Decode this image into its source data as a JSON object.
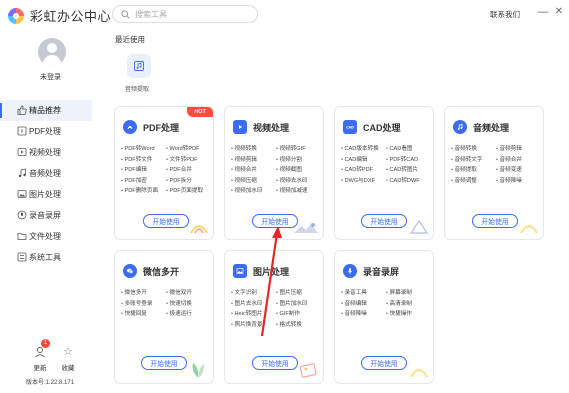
{
  "app": {
    "title": "彩虹办公中心"
  },
  "search": {
    "placeholder": "搜索工具"
  },
  "header": {
    "contact": "联系我们"
  },
  "window": {
    "minimize": "—",
    "close": "✕"
  },
  "user": {
    "login_label": "未登录"
  },
  "sidebar": {
    "items": [
      {
        "label": "精品推荐",
        "icon": "thumbs-up-icon",
        "active": true
      },
      {
        "label": "PDF处理",
        "icon": "pdf-icon"
      },
      {
        "label": "视频处理",
        "icon": "video-icon"
      },
      {
        "label": "音频处理",
        "icon": "music-icon"
      },
      {
        "label": "图片处理",
        "icon": "image-icon"
      },
      {
        "label": "录音录屏",
        "icon": "record-icon"
      },
      {
        "label": "文件处理",
        "icon": "folder-icon"
      },
      {
        "label": "系统工具",
        "icon": "system-icon"
      }
    ],
    "update_label": "更新",
    "update_badge": "1",
    "favorite_label": "收藏",
    "version": "版本号:1.22.8.171"
  },
  "recent": {
    "title": "最近使用",
    "items": [
      {
        "label": "音频提取",
        "icon": "audio-extract-icon"
      }
    ]
  },
  "cards": [
    {
      "title": "PDF处理",
      "hot": "HOT",
      "color": "#3b6cf2",
      "icon": "pdf-icon",
      "features": [
        "PDF转Word",
        "Word转PDF",
        "PDF转文件",
        "文件转PDF",
        "PDF编辑",
        "PDF合并",
        "PDF加密",
        "PDF拆分",
        "PDF删除页面",
        "PDF页面提取"
      ],
      "button": "开始使用"
    },
    {
      "title": "视频处理",
      "color": "#3b6cf2",
      "icon": "video-icon",
      "features": [
        "视频转换",
        "视频转GIF",
        "视频剪辑",
        "视频分割",
        "视频合并",
        "视频截图",
        "视频压缩",
        "视频去水印",
        "视频加水印",
        "视频加减速"
      ],
      "button": "开始使用"
    },
    {
      "title": "CAD处理",
      "color": "#3b6cf2",
      "icon": "cad-icon",
      "features": [
        "CAD版本转换",
        "CAD看图",
        "CAD编辑",
        "PDF转CAD",
        "CAD转PDF",
        "CAD转图片",
        "DWG与DXF",
        "CAD转DWF"
      ],
      "button": "开始使用"
    },
    {
      "title": "音频处理",
      "color": "#3b6cf2",
      "icon": "music-icon",
      "features": [
        "音频转换",
        "音频剪辑",
        "音频转文字",
        "音频合并",
        "音频提取",
        "音频变速",
        "音频调整",
        "音频降噪"
      ],
      "button": "开始使用"
    },
    {
      "title": "微信多开",
      "color": "#3b6cf2",
      "icon": "wechat-icon",
      "features": [
        "微信多开",
        "微信双开",
        "多账号登录",
        "快速切换",
        "快捷回复",
        "极速运行"
      ],
      "button": "开始使用"
    },
    {
      "title": "图片处理",
      "color": "#3b6cf2",
      "icon": "image-icon",
      "features": [
        "文字识别",
        "图片压缩",
        "图片去水印",
        "图片加水印",
        "Heic转图片",
        "GIF制作",
        "照片换背景",
        "格式转换"
      ],
      "button": "开始使用"
    },
    {
      "title": "录音录屏",
      "color": "#3b6cf2",
      "icon": "mic-icon",
      "features": [
        "录音工具",
        "屏幕录制",
        "音频编辑",
        "高清录制",
        "音频降噪",
        "快捷操作"
      ],
      "button": "开始使用"
    }
  ],
  "colors": {
    "accent": "#3b6cf2",
    "hot": "#ff4d3a",
    "annotation": "#e8262a"
  }
}
